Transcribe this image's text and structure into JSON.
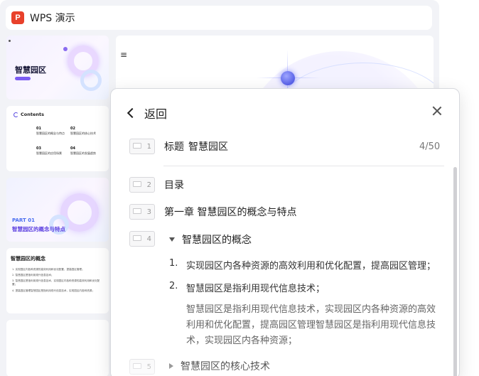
{
  "app": {
    "title": "WPS 演示",
    "logo_letter": "P",
    "brand_color": "#e8412b"
  },
  "thumbnails": {
    "t1": {
      "title": "智慧园区"
    },
    "t2": {
      "heading": "Contents",
      "items": [
        {
          "num": "01",
          "text": "智慧园区的概念与特点"
        },
        {
          "num": "02",
          "text": "智慧园区的核心技术"
        },
        {
          "num": "03",
          "text": "智慧园区的应用场景"
        },
        {
          "num": "04",
          "text": "智慧园区的发展趋势"
        }
      ]
    },
    "t3": {
      "part": "PART 01",
      "title": "智慧园区的概念与特点"
    },
    "t4": {
      "title": "智慧园区的概念",
      "lines": [
        "1. 实现园区内各种资源的高效利用和优化配置，提高园区管理；",
        "2. 智慧园区是指利用现代信息技术；",
        "3. 智慧园区是指利用现代信息技术，实现园区内各种资源的高效利用和优化配置；",
        "4. 提高园区管理智慧园区是指利用现代信息技术，实现园区内各种资源；"
      ]
    }
  },
  "main": {
    "menu_icon": "≡"
  },
  "dialog": {
    "back_label": "返回",
    "counter": "4/50",
    "rows": [
      {
        "num": "1",
        "prefix": "标题",
        "text": "智慧园区"
      },
      {
        "num": "2",
        "text": "目录"
      },
      {
        "num": "3",
        "text": "第一章  智慧园区的概念与特点"
      },
      {
        "num": "4"
      },
      {
        "num": "5"
      }
    ],
    "section_open": "智慧园区的概念",
    "list": [
      {
        "num": "1.",
        "text": "实现园区内各种资源的高效利用和优化配置，提高园区管理；"
      },
      {
        "num": "2.",
        "text": "智慧园区是指利用现代信息技术；"
      }
    ],
    "paragraph": "智慧园区是指利用现代信息技术，实现园区内各种资源的高效利用和优化配置，提高园区管理智慧园区是指利用现代信息技术，实现园区内各种资源；",
    "section_closed": "智慧园区的核心技术"
  }
}
